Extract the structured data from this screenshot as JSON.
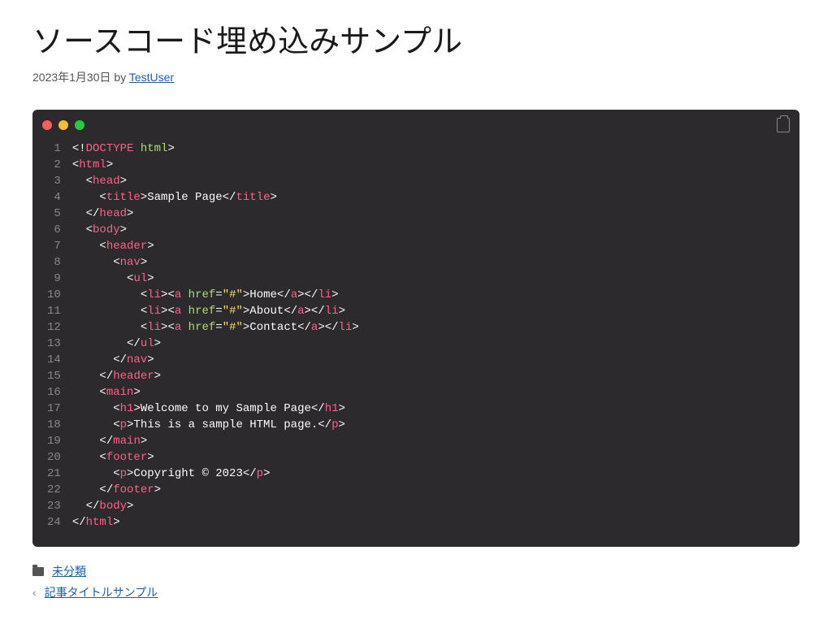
{
  "title": "ソースコード埋め込みサンプル",
  "meta": {
    "date": "2023年1月30日",
    "by": " by ",
    "author": "TestUser"
  },
  "code": {
    "line_numbers": [
      "1",
      "2",
      "3",
      "4",
      "5",
      "6",
      "7",
      "8",
      "9",
      "10",
      "11",
      "12",
      "13",
      "14",
      "15",
      "16",
      "17",
      "18",
      "19",
      "20",
      "21",
      "22",
      "23",
      "24"
    ],
    "lines": [
      [
        {
          "c": "white",
          "t": "<!"
        },
        {
          "c": "pink",
          "t": "DOCTYPE"
        },
        {
          "c": "white",
          "t": " "
        },
        {
          "c": "green",
          "t": "html"
        },
        {
          "c": "white",
          "t": ">"
        }
      ],
      [
        {
          "c": "white",
          "t": "<"
        },
        {
          "c": "pink",
          "t": "html"
        },
        {
          "c": "white",
          "t": ">"
        }
      ],
      [
        {
          "c": "white",
          "t": "  <"
        },
        {
          "c": "pink",
          "t": "head"
        },
        {
          "c": "white",
          "t": ">"
        }
      ],
      [
        {
          "c": "white",
          "t": "    <"
        },
        {
          "c": "pink",
          "t": "title"
        },
        {
          "c": "white",
          "t": ">Sample Page</"
        },
        {
          "c": "pink",
          "t": "title"
        },
        {
          "c": "white",
          "t": ">"
        }
      ],
      [
        {
          "c": "white",
          "t": "  </"
        },
        {
          "c": "pink",
          "t": "head"
        },
        {
          "c": "white",
          "t": ">"
        }
      ],
      [
        {
          "c": "white",
          "t": "  <"
        },
        {
          "c": "pink",
          "t": "body"
        },
        {
          "c": "white",
          "t": ">"
        }
      ],
      [
        {
          "c": "white",
          "t": "    <"
        },
        {
          "c": "pink",
          "t": "header"
        },
        {
          "c": "white",
          "t": ">"
        }
      ],
      [
        {
          "c": "white",
          "t": "      <"
        },
        {
          "c": "pink",
          "t": "nav"
        },
        {
          "c": "white",
          "t": ">"
        }
      ],
      [
        {
          "c": "white",
          "t": "        <"
        },
        {
          "c": "pink",
          "t": "ul"
        },
        {
          "c": "white",
          "t": ">"
        }
      ],
      [
        {
          "c": "white",
          "t": "          <"
        },
        {
          "c": "pink",
          "t": "li"
        },
        {
          "c": "white",
          "t": "><"
        },
        {
          "c": "pink",
          "t": "a"
        },
        {
          "c": "white",
          "t": " "
        },
        {
          "c": "green",
          "t": "href"
        },
        {
          "c": "white",
          "t": "="
        },
        {
          "c": "yellow",
          "t": "\"#\""
        },
        {
          "c": "white",
          "t": ">Home</"
        },
        {
          "c": "pink",
          "t": "a"
        },
        {
          "c": "white",
          "t": "></"
        },
        {
          "c": "pink",
          "t": "li"
        },
        {
          "c": "white",
          "t": ">"
        }
      ],
      [
        {
          "c": "white",
          "t": "          <"
        },
        {
          "c": "pink",
          "t": "li"
        },
        {
          "c": "white",
          "t": "><"
        },
        {
          "c": "pink",
          "t": "a"
        },
        {
          "c": "white",
          "t": " "
        },
        {
          "c": "green",
          "t": "href"
        },
        {
          "c": "white",
          "t": "="
        },
        {
          "c": "yellow",
          "t": "\"#\""
        },
        {
          "c": "white",
          "t": ">About</"
        },
        {
          "c": "pink",
          "t": "a"
        },
        {
          "c": "white",
          "t": "></"
        },
        {
          "c": "pink",
          "t": "li"
        },
        {
          "c": "white",
          "t": ">"
        }
      ],
      [
        {
          "c": "white",
          "t": "          <"
        },
        {
          "c": "pink",
          "t": "li"
        },
        {
          "c": "white",
          "t": "><"
        },
        {
          "c": "pink",
          "t": "a"
        },
        {
          "c": "white",
          "t": " "
        },
        {
          "c": "green",
          "t": "href"
        },
        {
          "c": "white",
          "t": "="
        },
        {
          "c": "yellow",
          "t": "\"#\""
        },
        {
          "c": "white",
          "t": ">Contact</"
        },
        {
          "c": "pink",
          "t": "a"
        },
        {
          "c": "white",
          "t": "></"
        },
        {
          "c": "pink",
          "t": "li"
        },
        {
          "c": "white",
          "t": ">"
        }
      ],
      [
        {
          "c": "white",
          "t": "        </"
        },
        {
          "c": "pink",
          "t": "ul"
        },
        {
          "c": "white",
          "t": ">"
        }
      ],
      [
        {
          "c": "white",
          "t": "      </"
        },
        {
          "c": "pink",
          "t": "nav"
        },
        {
          "c": "white",
          "t": ">"
        }
      ],
      [
        {
          "c": "white",
          "t": "    </"
        },
        {
          "c": "pink",
          "t": "header"
        },
        {
          "c": "white",
          "t": ">"
        }
      ],
      [
        {
          "c": "white",
          "t": "    <"
        },
        {
          "c": "pink",
          "t": "main"
        },
        {
          "c": "white",
          "t": ">"
        }
      ],
      [
        {
          "c": "white",
          "t": "      <"
        },
        {
          "c": "pink",
          "t": "h1"
        },
        {
          "c": "white",
          "t": ">Welcome to my Sample Page</"
        },
        {
          "c": "pink",
          "t": "h1"
        },
        {
          "c": "white",
          "t": ">"
        }
      ],
      [
        {
          "c": "white",
          "t": "      <"
        },
        {
          "c": "pink",
          "t": "p"
        },
        {
          "c": "white",
          "t": ">This is a sample HTML page.</"
        },
        {
          "c": "pink",
          "t": "p"
        },
        {
          "c": "white",
          "t": ">"
        }
      ],
      [
        {
          "c": "white",
          "t": "    </"
        },
        {
          "c": "pink",
          "t": "main"
        },
        {
          "c": "white",
          "t": ">"
        }
      ],
      [
        {
          "c": "white",
          "t": "    <"
        },
        {
          "c": "pink",
          "t": "footer"
        },
        {
          "c": "white",
          "t": ">"
        }
      ],
      [
        {
          "c": "white",
          "t": "      <"
        },
        {
          "c": "pink",
          "t": "p"
        },
        {
          "c": "white",
          "t": ">Copyright © 2023</"
        },
        {
          "c": "pink",
          "t": "p"
        },
        {
          "c": "white",
          "t": ">"
        }
      ],
      [
        {
          "c": "white",
          "t": "    </"
        },
        {
          "c": "pink",
          "t": "footer"
        },
        {
          "c": "white",
          "t": ">"
        }
      ],
      [
        {
          "c": "white",
          "t": "  </"
        },
        {
          "c": "pink",
          "t": "body"
        },
        {
          "c": "white",
          "t": ">"
        }
      ],
      [
        {
          "c": "white",
          "t": "</"
        },
        {
          "c": "pink",
          "t": "html"
        },
        {
          "c": "white",
          "t": ">"
        }
      ]
    ]
  },
  "footer": {
    "category": "未分類",
    "prev_post": "記事タイトルサンプル"
  }
}
